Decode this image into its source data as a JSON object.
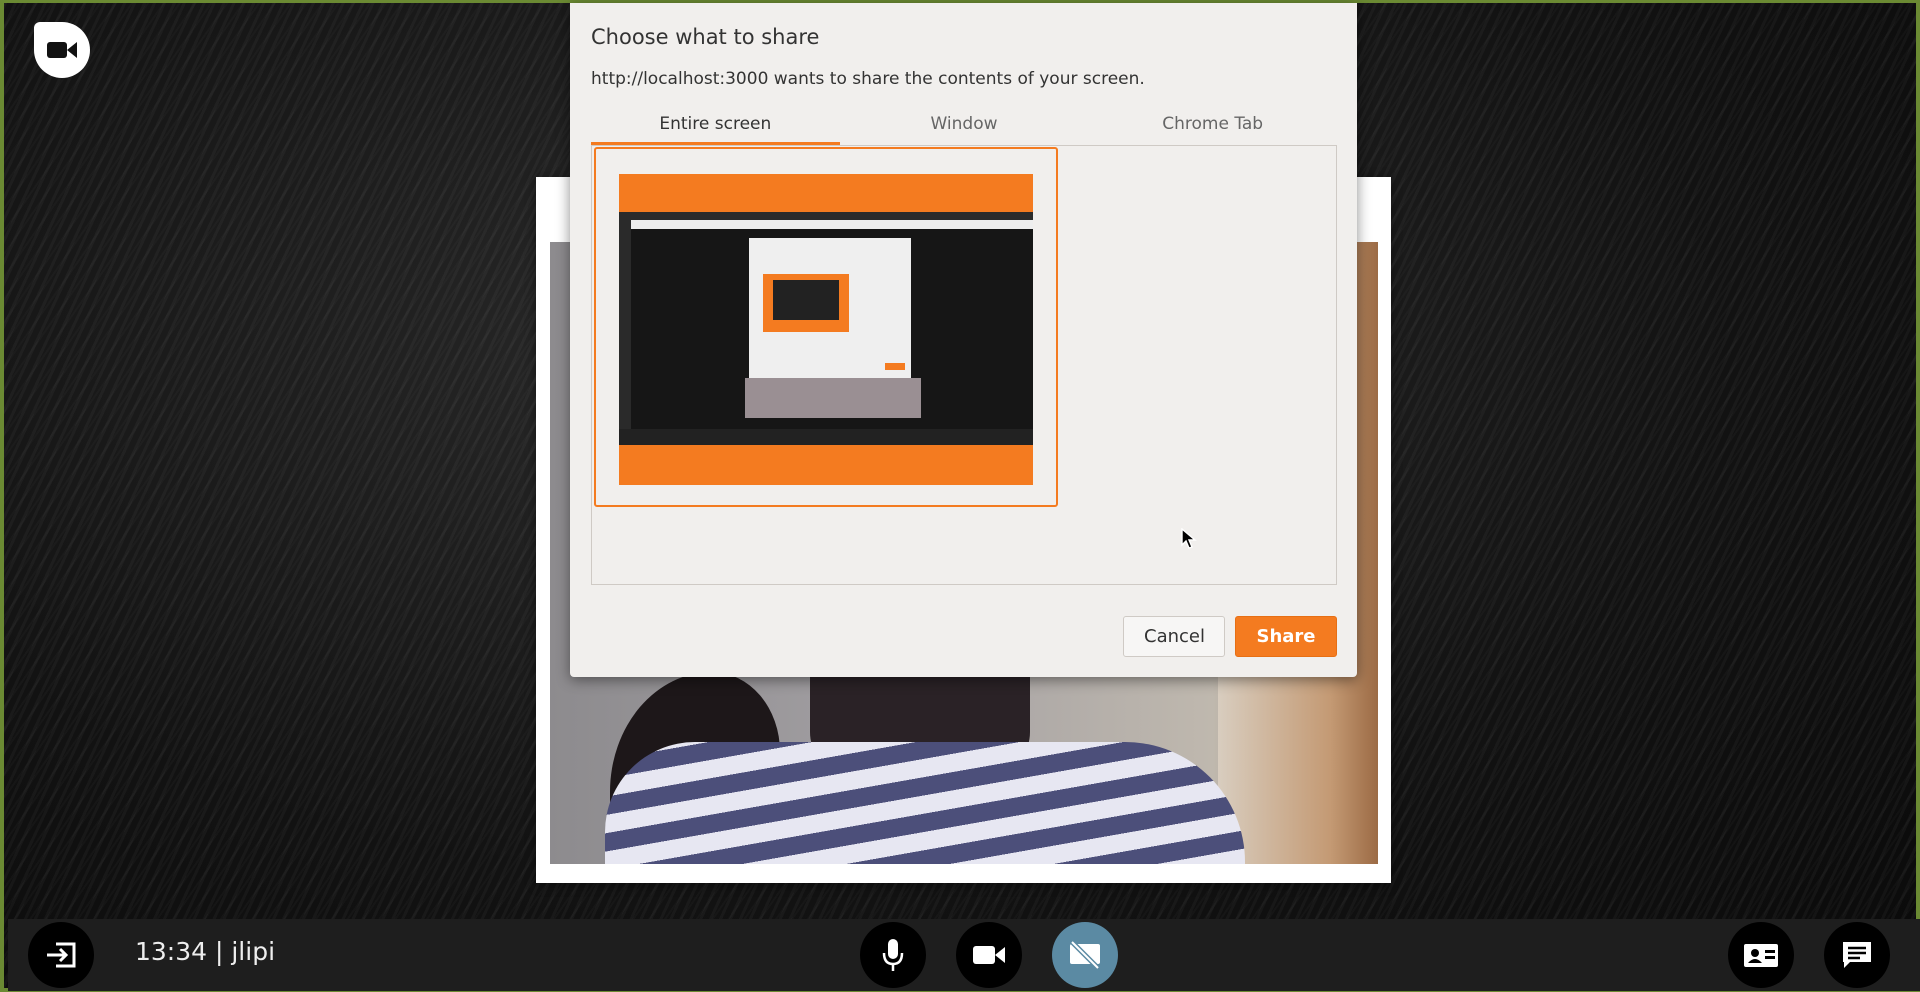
{
  "app": {
    "logo_icon": "video-camera-icon"
  },
  "dialog": {
    "title": "Choose what to share",
    "subtitle": "http://localhost:3000 wants to share the contents of your screen.",
    "tabs": [
      {
        "label": "Entire screen",
        "active": true
      },
      {
        "label": "Window",
        "active": false
      },
      {
        "label": "Chrome Tab",
        "active": false
      }
    ],
    "cancel_label": "Cancel",
    "share_label": "Share"
  },
  "bottom_bar": {
    "status": "13:34 | jlipi",
    "leave_icon": "leave-call-icon",
    "mic_icon": "microphone-icon",
    "camera_icon": "video-camera-icon",
    "screenshare_icon": "screen-share-off-icon",
    "participants_icon": "contact-card-icon",
    "chat_icon": "chat-icon"
  },
  "colors": {
    "accent": "#f47b20",
    "screenshare_active": "#5b8aa3"
  }
}
